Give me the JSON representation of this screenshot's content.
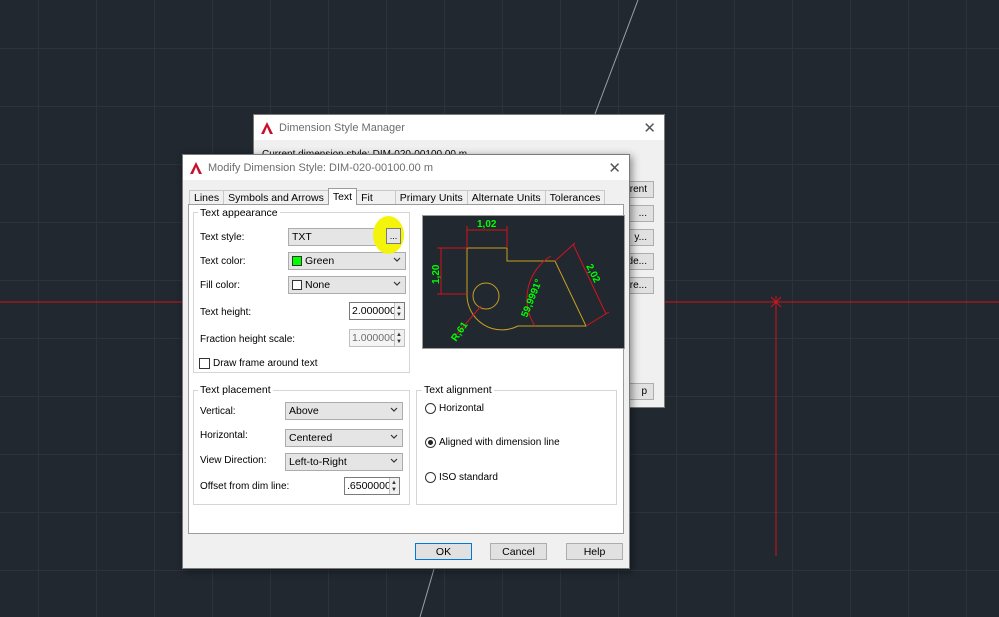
{
  "colors": {
    "canvas_bg": "#212830",
    "crosshair": "#d4141c",
    "dim_green": "#00ff00",
    "geometry_yellow": "#c8a020",
    "highlight": "#f4f40a"
  },
  "dsm": {
    "title": "Dimension Style Manager",
    "current_style_text": "Current dimension style: DIM-020-00100.00 m",
    "btn_set_current": "rrent",
    "btn_new": "...",
    "btn_modify": "y...",
    "btn_override": "de...",
    "btn_compare": "are...",
    "btn_help": "p"
  },
  "mds": {
    "title": "Modify Dimension Style: DIM-020-00100.00 m",
    "tabs": [
      {
        "label": "Lines"
      },
      {
        "label": "Symbols and Arrows"
      },
      {
        "label": "Text"
      },
      {
        "label": "Fit"
      },
      {
        "label": "Primary Units"
      },
      {
        "label": "Alternate Units"
      },
      {
        "label": "Tolerances"
      }
    ],
    "text_appearance": {
      "group_label": "Text appearance",
      "text_style_label": "Text style:",
      "text_style_value": "TXT",
      "browse_label": "...",
      "text_color_label": "Text color:",
      "text_color_value": "Green",
      "fill_color_label": "Fill color:",
      "fill_color_value": "None",
      "text_height_label": "Text height:",
      "text_height_value": "2.0000000",
      "fraction_scale_label": "Fraction height scale:",
      "fraction_scale_value": "1.0000000",
      "draw_frame_label": "Draw frame around text"
    },
    "text_placement": {
      "group_label": "Text placement",
      "vertical_label": "Vertical:",
      "vertical_value": "Above",
      "horizontal_label": "Horizontal:",
      "horizontal_value": "Centered",
      "view_direction_label": "View Direction:",
      "view_direction_value": "Left-to-Right",
      "offset_label": "Offset from dim line:",
      "offset_value": ".6500000"
    },
    "text_alignment": {
      "group_label": "Text alignment",
      "options": [
        {
          "label": "Horizontal",
          "selected": false
        },
        {
          "label": "Aligned with dimension line",
          "selected": true
        },
        {
          "label": "ISO standard",
          "selected": false
        }
      ]
    },
    "preview": {
      "dim_top": "1,02",
      "dim_left": "1,20",
      "dim_angle": "59,9991°",
      "dim_right": "2,02",
      "dim_radius": "R,61"
    },
    "buttons": {
      "ok": "OK",
      "cancel": "Cancel",
      "help": "Help"
    }
  }
}
